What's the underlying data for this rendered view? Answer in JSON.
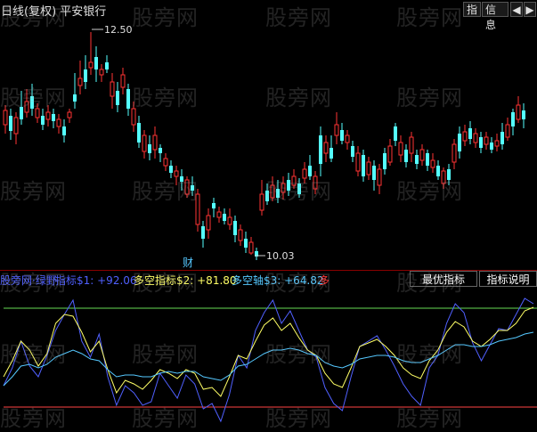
{
  "header": {
    "period": "日线(复权)",
    "stock_name": "平安银行",
    "buttons": {
      "zhi": "指",
      "info": "信息",
      "prev": "◀",
      "next": "▶"
    }
  },
  "main": {
    "high_label": "12.50",
    "low_label": "10.03",
    "cai_marker": "财",
    "up_color": "#ff3333",
    "down_color": "#54ffff"
  },
  "indicator": {
    "name": "股旁网·绿野",
    "s1": "指标$1: +92.06",
    "s2": "多空指标$2: +81.80",
    "s3": "多空轴$3: +64.82",
    "more": "多",
    "btn_best": "最优指标",
    "btn_desc": "指标说明",
    "top_line_color": "#66dd55",
    "bottom_line_color": "#ff4444",
    "s1_color": "#5060ff",
    "s2_color": "#ffff66",
    "s3_color": "#55c8ff"
  },
  "watermark": "股旁网"
}
